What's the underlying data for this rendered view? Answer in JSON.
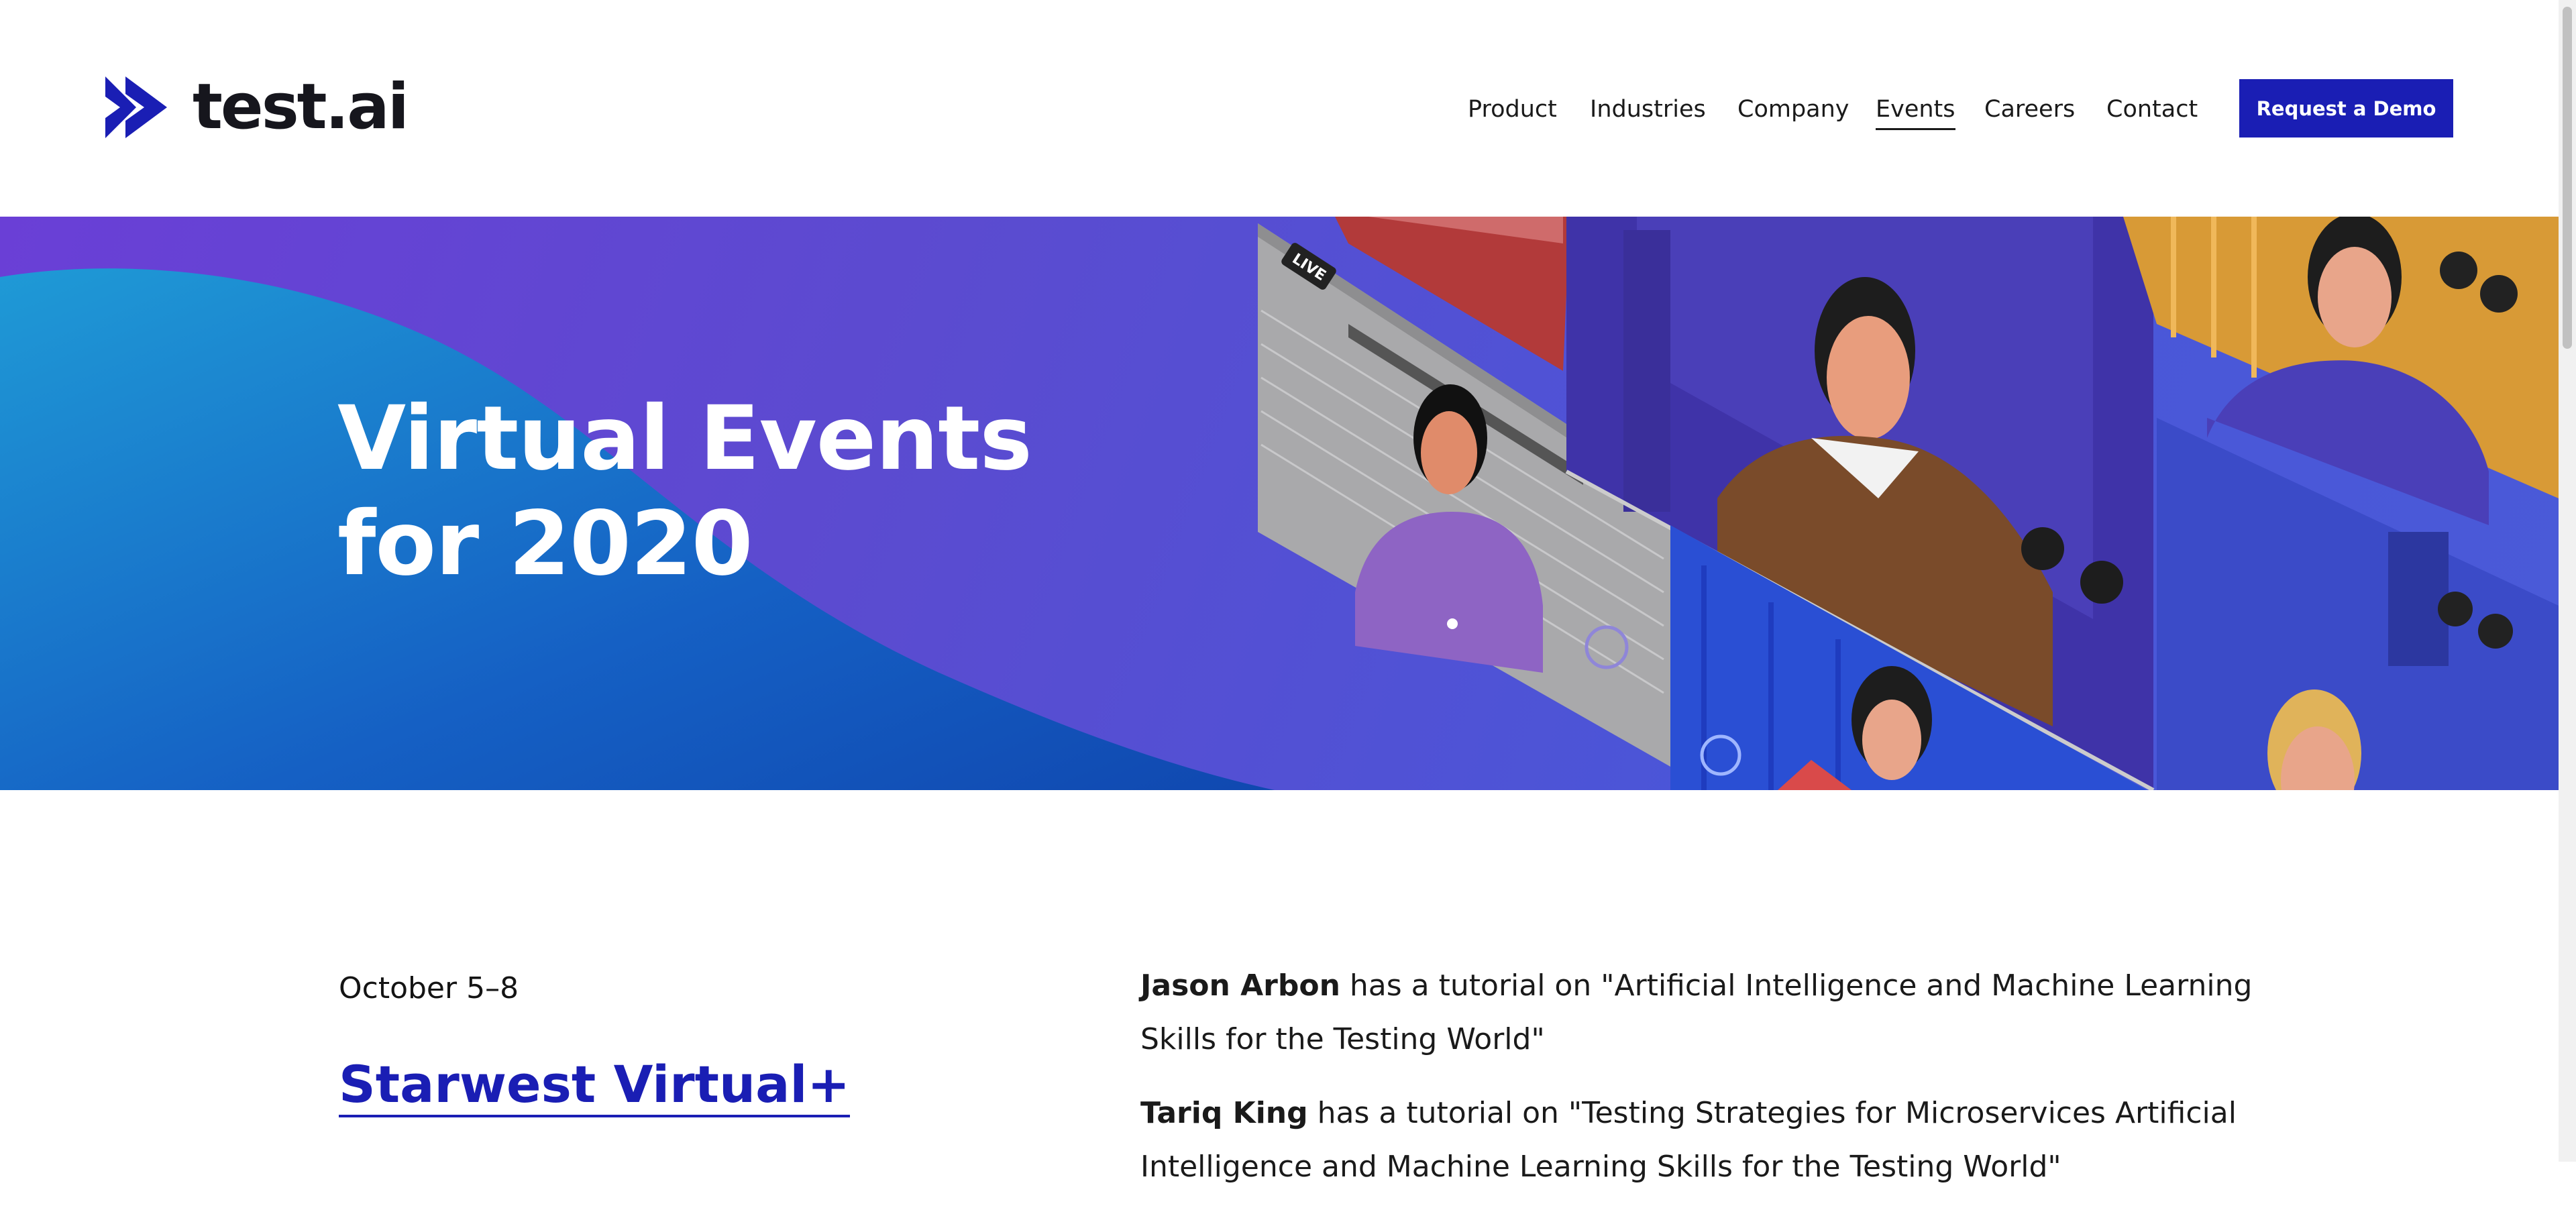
{
  "brand": {
    "name": "test.ai",
    "accent": "#1a1eb4"
  },
  "nav": {
    "items": [
      {
        "label": "Product"
      },
      {
        "label": "Industries"
      },
      {
        "label": "Company"
      },
      {
        "label": "Events",
        "active": true
      },
      {
        "label": "Careers"
      },
      {
        "label": "Contact"
      }
    ],
    "cta_label": "Request a Demo"
  },
  "hero": {
    "title_line1": "Virtual Events",
    "title_line2": "for 2020",
    "badge_label": "LIVE"
  },
  "event": {
    "date": "October 5–8",
    "title": "Starwest Virtual+",
    "entries": [
      {
        "name": "Jason Arbon",
        "text": " has a tutorial on \"Artificial Intelligence and Machine Learning Skills for the Testing World\""
      },
      {
        "name": "Tariq King",
        "text": " has a tutorial on \"Testing Strategies for Microservices Artificial Intelligence and Machine Learning Skills for the Testing World\""
      }
    ]
  }
}
